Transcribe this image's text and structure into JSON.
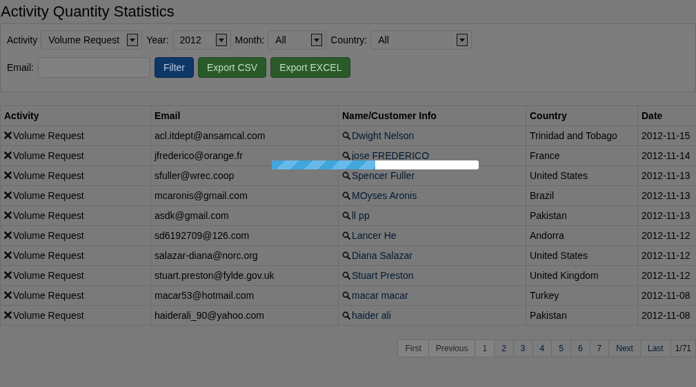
{
  "title": "Activity Quantity Statistics",
  "filters": [
    {
      "label": "Activity",
      "value": "Volume Request"
    },
    {
      "label": "Year:",
      "value": "2012"
    },
    {
      "label": "Month:",
      "value": "All"
    },
    {
      "label": "Country:",
      "value": "All"
    }
  ],
  "email": {
    "label": "Email:"
  },
  "buttons": [
    {
      "label": "Filter",
      "kind": "primary"
    },
    {
      "label": "Export CSV",
      "kind": "success"
    },
    {
      "label": "Export EXCEL",
      "kind": "success"
    }
  ],
  "table": {
    "columns": [
      "Activity",
      "Email",
      "Name/Customer Info",
      "Country",
      "Date"
    ],
    "rows": [
      {
        "activity": "Volume Request",
        "email": "acl.itdept@ansamcal.com",
        "name": "Dwight Nelson",
        "country": "Trinidad and Tobago",
        "date": "2012-11-15"
      },
      {
        "activity": "Volume Request",
        "email": "jfrederico@orange.fr",
        "name": "jose FREDERICO",
        "country": "France",
        "date": "2012-11-14"
      },
      {
        "activity": "Volume Request",
        "email": "sfuller@wrec.coop",
        "name": "Spencer Fuller",
        "country": "United States",
        "date": "2012-11-13"
      },
      {
        "activity": "Volume Request",
        "email": "mcaronis@gmail.com",
        "name": "MOyses Aronis",
        "country": "Brazil",
        "date": "2012-11-13"
      },
      {
        "activity": "Volume Request",
        "email": "asdk@gmail.com",
        "name": "ll pp",
        "country": "Pakistan",
        "date": "2012-11-13"
      },
      {
        "activity": "Volume Request",
        "email": "sd6192709@126.com",
        "name": "Lancer He",
        "country": "Andorra",
        "date": "2012-11-12"
      },
      {
        "activity": "Volume Request",
        "email": "salazar-diana@norc.org",
        "name": "Diana Salazar",
        "country": "United States",
        "date": "2012-11-12"
      },
      {
        "activity": "Volume Request",
        "email": "stuart.preston@fylde.gov.uk",
        "name": "Stuart Preston",
        "country": "United Kingdom",
        "date": "2012-11-12"
      },
      {
        "activity": "Volume Request",
        "email": "macar53@hotmail.com",
        "name": "macar macar",
        "country": "Turkey",
        "date": "2012-11-08"
      },
      {
        "activity": "Volume Request",
        "email": "haiderali_90@yahoo.com",
        "name": "haider ali",
        "country": "Pakistan",
        "date": "2012-11-08"
      }
    ]
  },
  "pagination": {
    "pages": [
      {
        "label": "First",
        "disabled": true
      },
      {
        "label": "Previous",
        "disabled": true
      },
      {
        "label": "1",
        "disabled": true
      },
      {
        "label": "2",
        "disabled": false
      },
      {
        "label": "3",
        "disabled": false
      },
      {
        "label": "4",
        "disabled": false
      },
      {
        "label": "5",
        "disabled": false
      },
      {
        "label": "6",
        "disabled": false
      },
      {
        "label": "7",
        "disabled": false
      },
      {
        "label": "Next",
        "disabled": false
      },
      {
        "label": "Last",
        "disabled": false
      }
    ],
    "info": "1/71"
  },
  "progress": {
    "level": 0.5
  }
}
